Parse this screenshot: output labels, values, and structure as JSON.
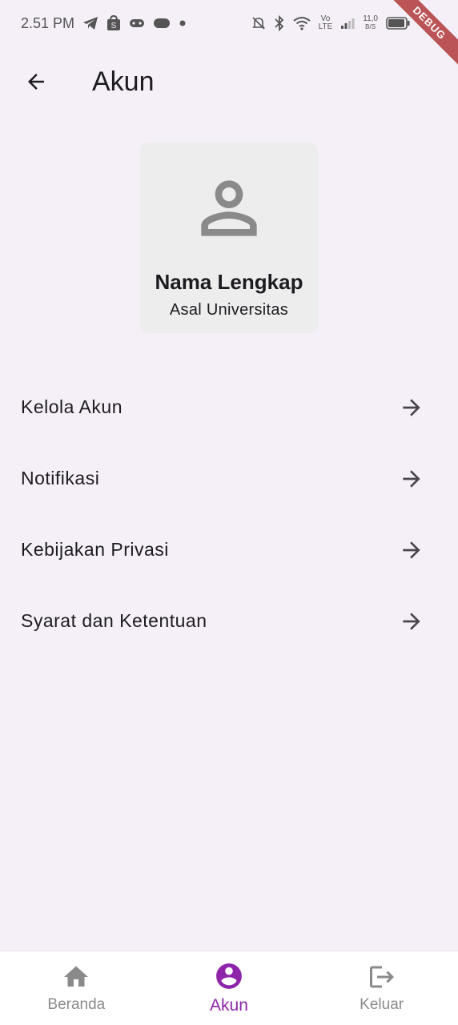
{
  "status_bar": {
    "time": "2.51 PM",
    "speed_value": "11,0",
    "speed_unit": "B/S",
    "volte": "Vo",
    "lte": "LTE",
    "icons": [
      "telegram-icon",
      "shopee-icon",
      "gamepad-icon",
      "games-badge-icon",
      "dot-icon",
      "mute-icon",
      "bluetooth-icon",
      "wifi-icon",
      "signal-icon",
      "battery-icon"
    ]
  },
  "debug_banner": "DEBUG",
  "app_bar": {
    "title": "Akun"
  },
  "profile": {
    "name": "Nama Lengkap",
    "university": "Asal Universitas"
  },
  "menu": {
    "items": [
      {
        "label": "Kelola Akun"
      },
      {
        "label": "Notifikasi"
      },
      {
        "label": "Kebijakan Privasi"
      },
      {
        "label": "Syarat dan Ketentuan"
      }
    ]
  },
  "bottom_nav": {
    "items": [
      {
        "label": "Beranda",
        "icon": "home-icon"
      },
      {
        "label": "Akun",
        "icon": "account-circle-icon"
      },
      {
        "label": "Keluar",
        "icon": "logout-icon"
      }
    ],
    "active_index": 1
  },
  "colors": {
    "background": "#f5eff7",
    "accent": "#8e24aa",
    "card": "#ededed",
    "inactive": "#8a8a8a"
  }
}
